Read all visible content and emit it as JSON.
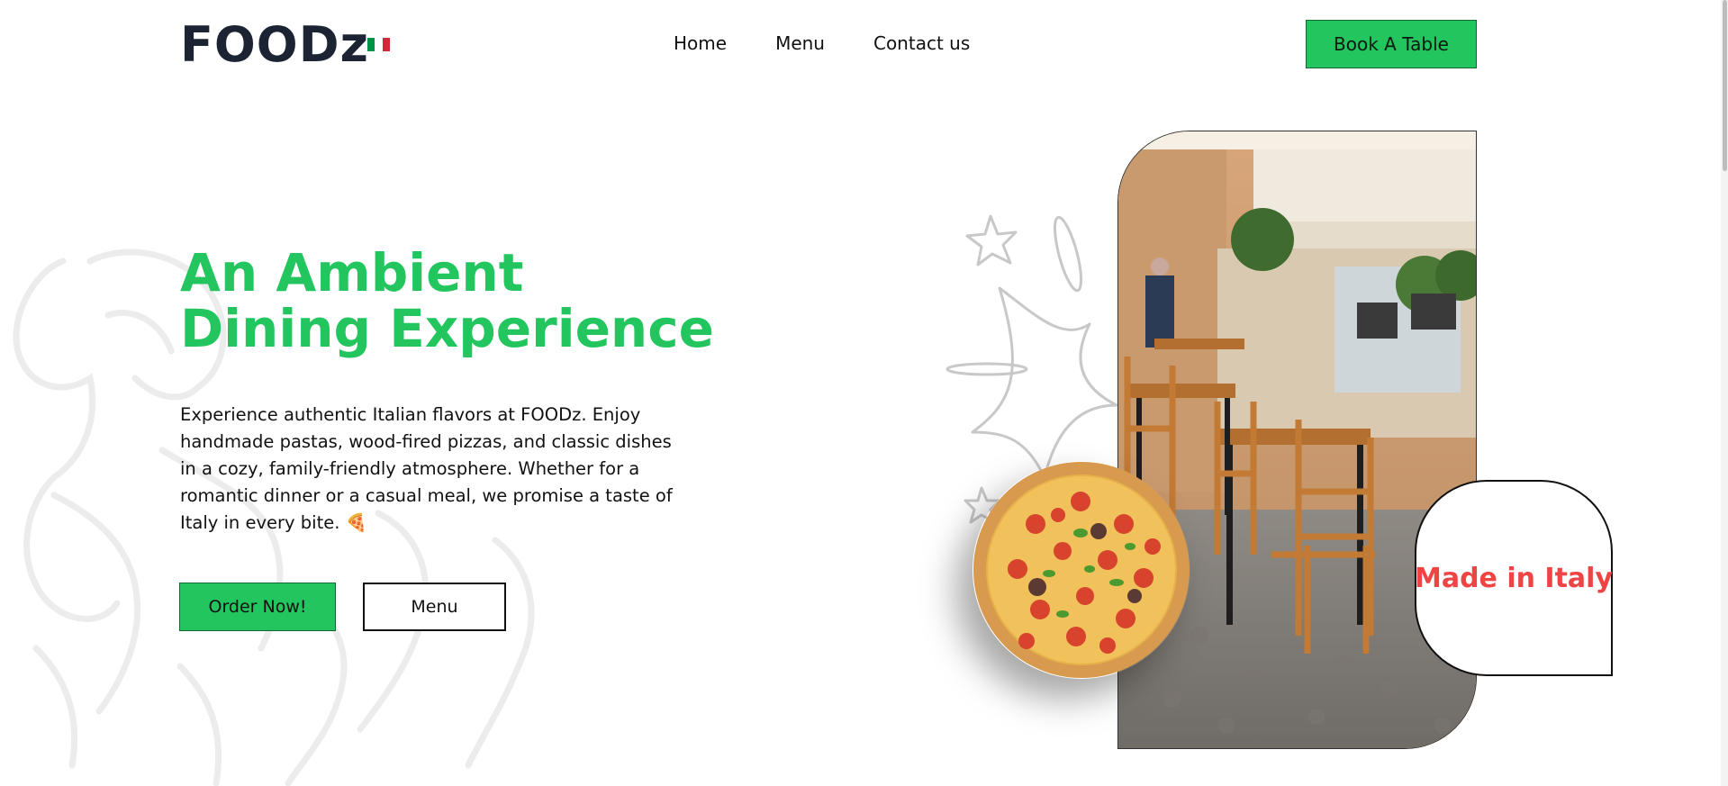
{
  "header": {
    "logo": "FOODz",
    "nav": [
      "Home",
      "Menu",
      "Contact us"
    ],
    "book_button": "Book A Table"
  },
  "hero": {
    "title_line1": "An Ambient",
    "title_line2": "Dining Experience",
    "description": "Experience authentic Italian flavors at FOODz. Enjoy handmade pastas, wood-fired pizzas, and classic dishes in a cozy, family-friendly atmosphere. Whether for a romantic dinner or a casual meal, we promise a taste of Italy in every bite. 🍕",
    "order_button": "Order Now!",
    "menu_button": "Menu"
  },
  "badge": {
    "text": "Made in Italy"
  },
  "colors": {
    "accent": "#22c55e",
    "badge_text": "#ef4444",
    "logo": "#1c2433",
    "flag": [
      "#009246",
      "#ffffff",
      "#ce2b37"
    ]
  },
  "icons": {
    "flag": "italy-flag-icon",
    "pizza": "pizza-image",
    "photo": "restaurant-terrace-photo"
  }
}
